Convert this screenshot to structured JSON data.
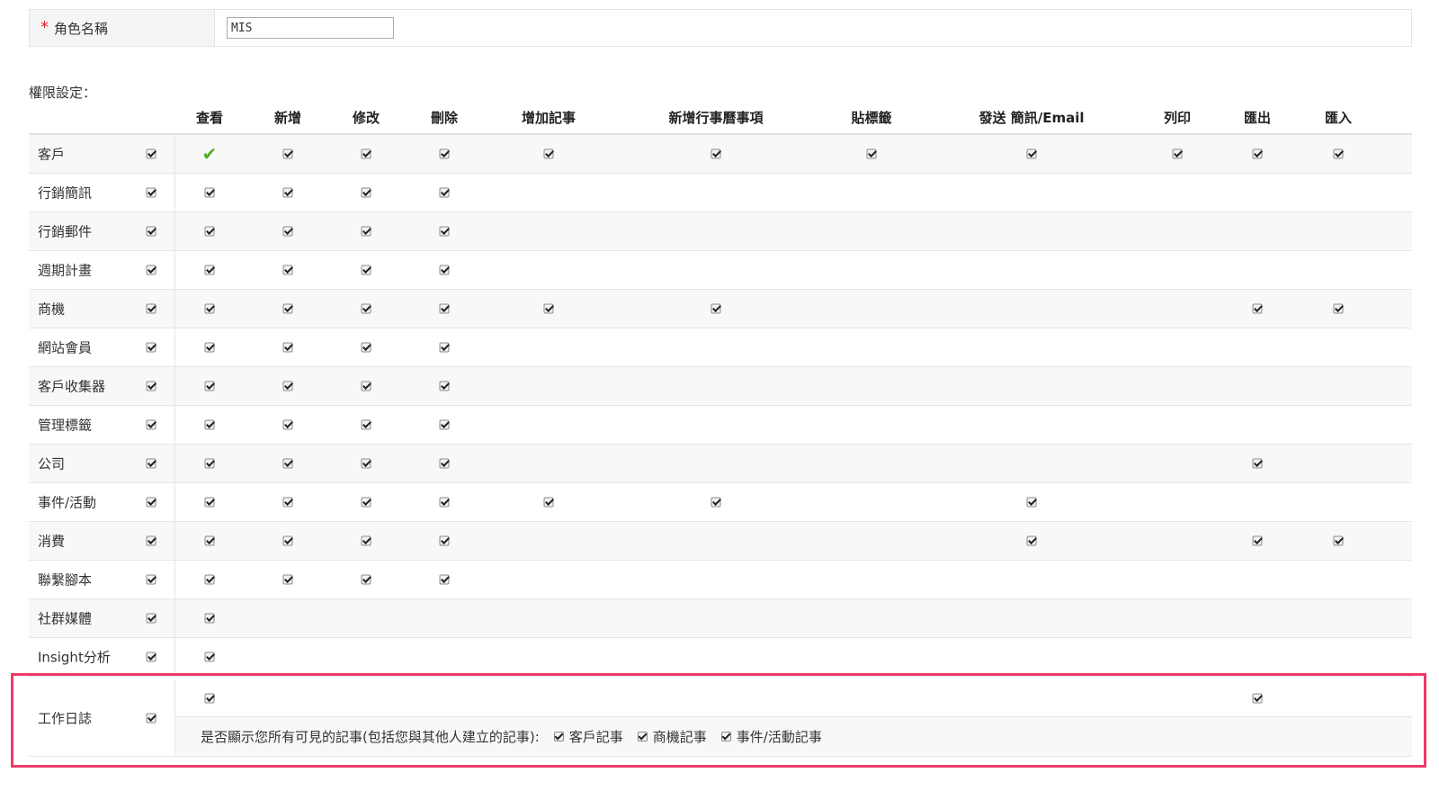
{
  "role": {
    "label": "角色名稱",
    "required_mark": "*",
    "value": "MIS"
  },
  "permissions_title": "權限設定：",
  "columns": [
    "查看",
    "新增",
    "修改",
    "刪除",
    "增加記事",
    "新增行事曆事項",
    "貼標籤",
    "發送 簡訊/Email",
    "列印",
    "匯出",
    "匯入"
  ],
  "rows": [
    {
      "name": "客戶",
      "checks": [
        0,
        1,
        2,
        3,
        4,
        5,
        6,
        7,
        8,
        9,
        10
      ],
      "green_view": true
    },
    {
      "name": "行銷簡訊",
      "checks": [
        0,
        1,
        2,
        3
      ]
    },
    {
      "name": "行銷郵件",
      "checks": [
        0,
        1,
        2,
        3
      ]
    },
    {
      "name": "週期計畫",
      "checks": [
        0,
        1,
        2,
        3
      ]
    },
    {
      "name": "商機",
      "checks": [
        0,
        1,
        2,
        3,
        4,
        5,
        9,
        10
      ]
    },
    {
      "name": "網站會員",
      "checks": [
        0,
        1,
        2,
        3
      ]
    },
    {
      "name": "客戶收集器",
      "checks": [
        0,
        1,
        2,
        3
      ]
    },
    {
      "name": "管理標籤",
      "checks": [
        0,
        1,
        2,
        3
      ]
    },
    {
      "name": "公司",
      "checks": [
        0,
        1,
        2,
        3,
        9
      ]
    },
    {
      "name": "事件/活動",
      "checks": [
        0,
        1,
        2,
        3,
        4,
        5,
        7
      ]
    },
    {
      "name": "消費",
      "checks": [
        0,
        1,
        2,
        3,
        7,
        9,
        10
      ]
    },
    {
      "name": "聯繫腳本",
      "checks": [
        0,
        1,
        2,
        3
      ]
    },
    {
      "name": "社群媒體",
      "checks": [
        0
      ]
    },
    {
      "name": "Insight分析",
      "checks": [
        0
      ]
    }
  ],
  "worklog": {
    "name": "工作日誌",
    "checks": [
      0,
      9
    ],
    "question": "是否顯示您所有可見的記事(包括您與其他人建立的記事):",
    "options": [
      "客戶記事",
      "商機記事",
      "事件/活動記事"
    ]
  }
}
